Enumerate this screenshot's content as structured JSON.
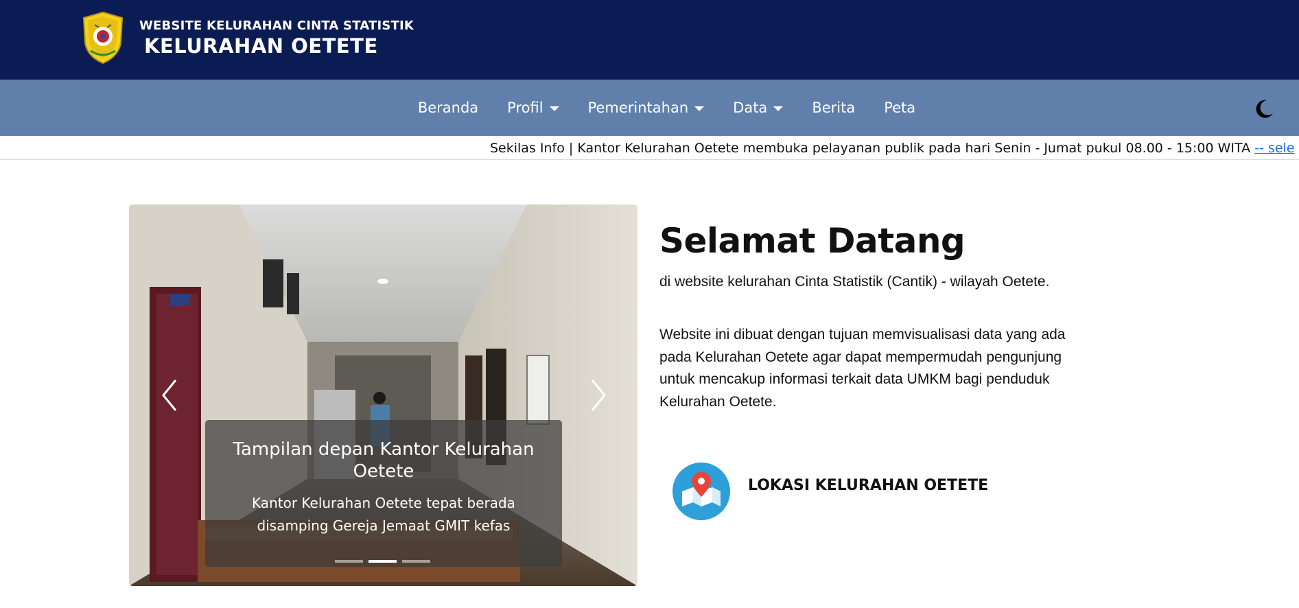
{
  "header": {
    "site_subtitle": "WEBSITE KELURAHAN CINTA STATISTIK",
    "site_title": "KELURAHAN OETETE",
    "logo_icon": "emblem-shield-icon",
    "background_color": "#0b1c55"
  },
  "navbar": {
    "background_color": "#6080ab",
    "items": [
      {
        "label": "Beranda",
        "dropdown": false
      },
      {
        "label": "Profil",
        "dropdown": true
      },
      {
        "label": "Pemerintahan",
        "dropdown": true
      },
      {
        "label": "Data",
        "dropdown": true
      },
      {
        "label": "Berita",
        "dropdown": false
      },
      {
        "label": "Peta",
        "dropdown": false
      }
    ],
    "theme_toggle_icon": "moon-icon"
  },
  "ticker": {
    "text": "Sekilas Info | Kantor Kelurahan Oetete membuka pelayanan publik pada hari Senin - Jumat pukul 08.00 - 15:00 WITA ",
    "link_text": "-- sele"
  },
  "carousel": {
    "caption_title": "Tampilan depan Kantor Kelurahan Oetete",
    "caption_text": "Kantor Kelurahan Oetete tepat berada disamping Gereja Jemaat GMIT kefas",
    "slide_count": 3,
    "active_slide": 2,
    "prev_icon": "chevron-left-icon",
    "next_icon": "chevron-right-icon"
  },
  "welcome": {
    "title": "Selamat Datang",
    "subtitle": "di website kelurahan Cinta Statistik (Cantik) - wilayah Oetete.",
    "description": "Website ini dibuat dengan tujuan memvisualisasi data yang ada pada Kelurahan Oetete agar dapat mempermudah pengunjung untuk mencakup informasi terkait data UMKM bagi penduduk Kelurahan Oetete."
  },
  "location": {
    "label": "LOKASI KELURAHAN OETETE",
    "icon": "map-pin-icon",
    "icon_color": "#2d9fd9"
  }
}
